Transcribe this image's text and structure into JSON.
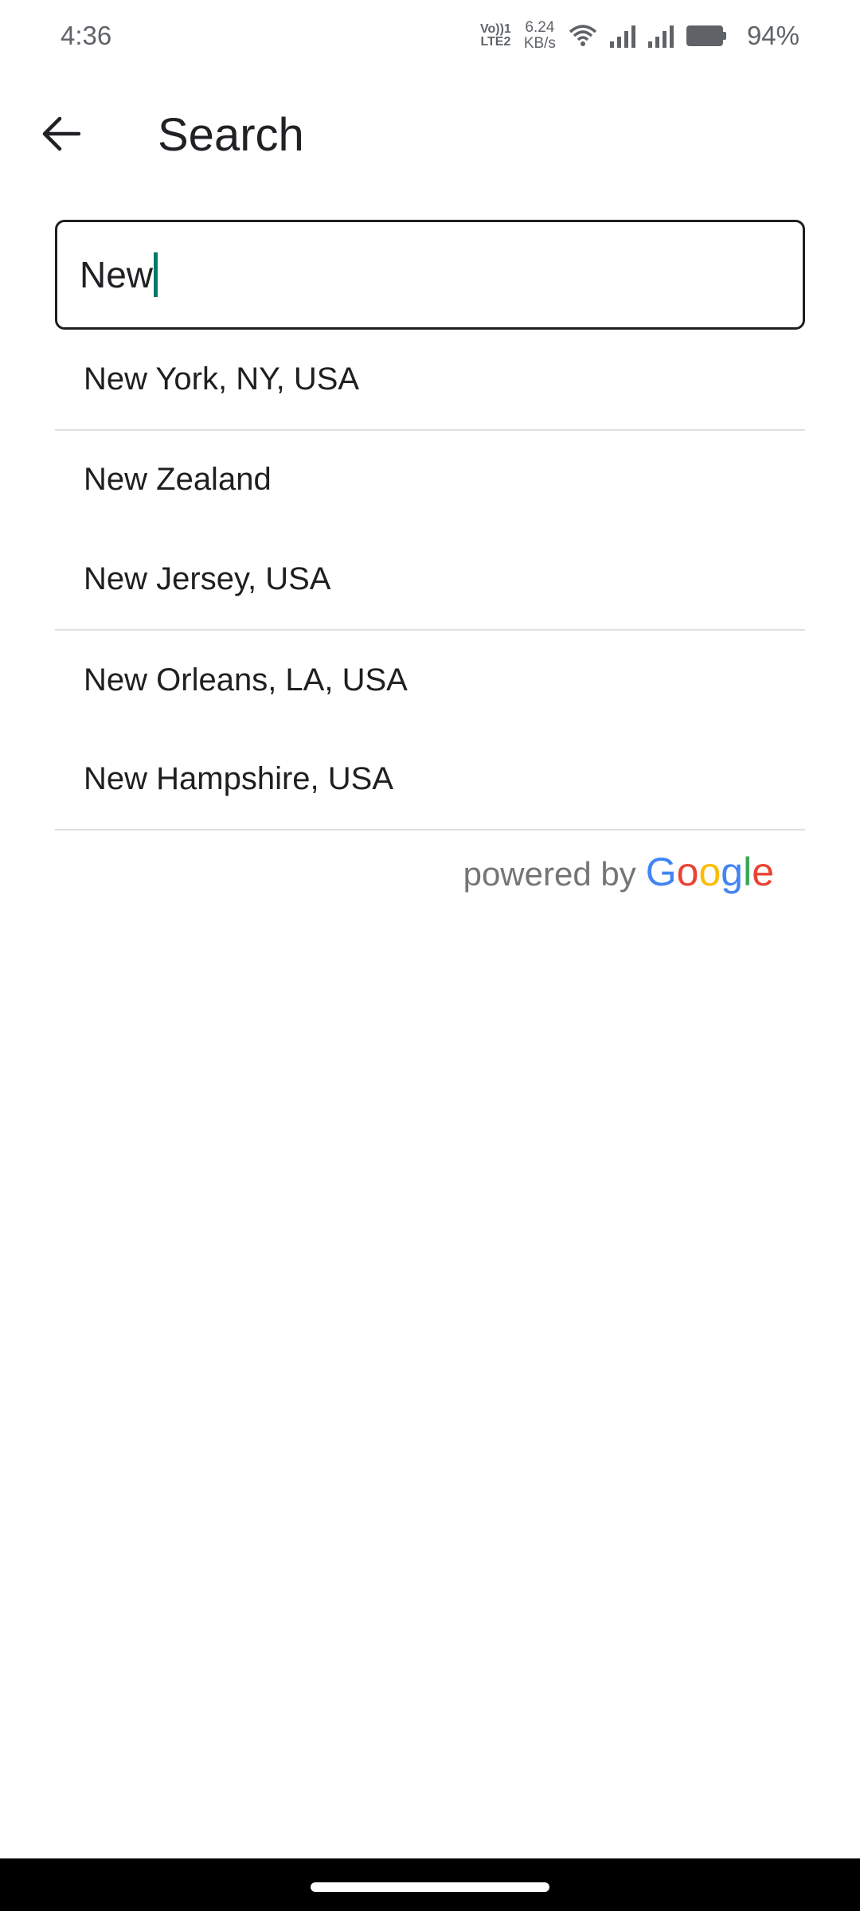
{
  "status_bar": {
    "time": "4:36",
    "volte_line1": "Vo))1",
    "volte_line2": "LTE2",
    "net_speed_value": "6.24",
    "net_speed_unit": "KB/s",
    "battery_percent": "94%",
    "icons": [
      "volte-icon",
      "wifi-icon",
      "signal-icon",
      "signal-icon",
      "battery-icon"
    ]
  },
  "header": {
    "back_icon": "arrow-left-icon",
    "title": "Search"
  },
  "search": {
    "value": "New"
  },
  "results": [
    {
      "label": "New York, NY, USA"
    },
    {
      "label": "New Zealand"
    },
    {
      "label": "New Jersey, USA"
    },
    {
      "label": "New Orleans, LA, USA"
    },
    {
      "label": "New Hampshire, USA"
    }
  ],
  "attribution": {
    "powered_by": "powered by",
    "brand": "Google",
    "brand_colors": [
      "#4285F4",
      "#EA4335",
      "#FBBC05",
      "#4285F4",
      "#34A853",
      "#EA4335"
    ]
  },
  "colors": {
    "caret": "#00796b",
    "divider": "#e0e0e0",
    "nav_bar": "#000000"
  }
}
